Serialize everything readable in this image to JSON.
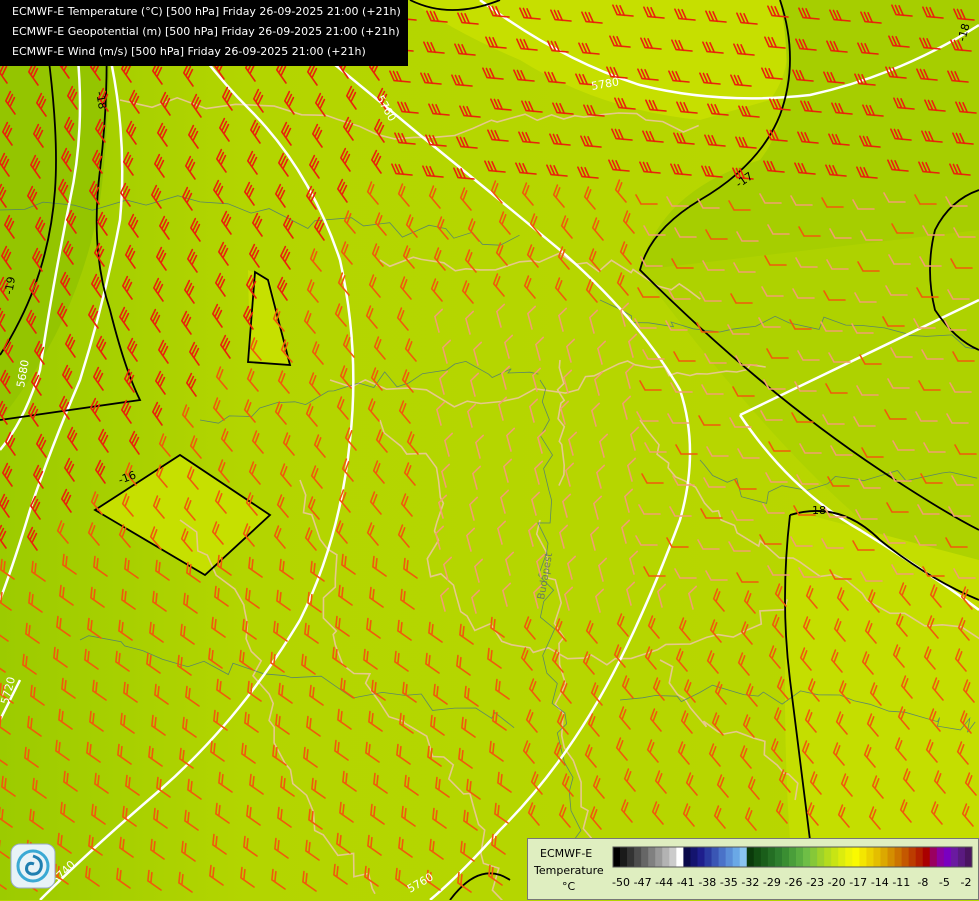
{
  "header": {
    "line1": "ECMWF-E Temperature (°C) [500 hPa] Friday 26-09-2025 21:00 (+21h)",
    "line2": "ECMWF-E Geopotential (m) [500 hPa] Friday 26-09-2025 21:00 (+21h)",
    "line3": "ECMWF-E Wind (m/s) [500 hPa] Friday 26-09-2025 21:00 (+21h)"
  },
  "legend": {
    "model": "ECMWF-E",
    "variable": "Temperature",
    "unit": "°C",
    "ticks": [
      "-50",
      "-47",
      "-44",
      "-41",
      "-38",
      "-35",
      "-32",
      "-29",
      "-26",
      "-23",
      "-20",
      "-17",
      "-14",
      "-11",
      "-8",
      "-5",
      "-2"
    ],
    "colors": [
      "#000000",
      "#1a1a1a",
      "#333333",
      "#4d4d4d",
      "#666666",
      "#808080",
      "#999999",
      "#b3b3b3",
      "#cccccc",
      "#ffffff",
      "#0a0a4a",
      "#14146e",
      "#1e1e8c",
      "#2a3aa0",
      "#3a56b4",
      "#4a72c8",
      "#5a8ed8",
      "#6aa8e6",
      "#8ac4f0",
      "#0a3a0a",
      "#124e12",
      "#1a5e1a",
      "#246e24",
      "#2e7e2e",
      "#3a8e32",
      "#4a9e3a",
      "#5aae40",
      "#6ebe46",
      "#86c838",
      "#9ed22a",
      "#b4dc1e",
      "#c8e414",
      "#dcec0e",
      "#eef408",
      "#fafa00",
      "#f4e600",
      "#ecd200",
      "#e4be00",
      "#dca800",
      "#d48e00",
      "#cc7400",
      "#c45800",
      "#bc3c00",
      "#b42000",
      "#aa0000",
      "#9a0060",
      "#8a00a0",
      "#7a00c0",
      "#6a1aa0",
      "#5a1a80",
      "#4a1460"
    ]
  },
  "contours": {
    "geopotential_labels": [
      "5760",
      "5780",
      "5740",
      "5760",
      "5720",
      "5680"
    ],
    "temperature_labels": [
      "-18",
      "-17",
      "-16",
      "-18",
      "-19",
      "-18"
    ]
  },
  "place_label": "Budapest",
  "colors": {
    "field_main": "#b7d600",
    "field_yellow": "#c8e000",
    "field_green": "#a2cc00",
    "field_darkgreen": "#8ec400",
    "barb_red": "#e8230a",
    "barb_orange": "#f05a0a",
    "barb_pink": "#f0a070",
    "geopotential_line": "#ffffff",
    "temperature_line": "#000000",
    "border": "#e8c890",
    "river": "#3a6a8a"
  }
}
